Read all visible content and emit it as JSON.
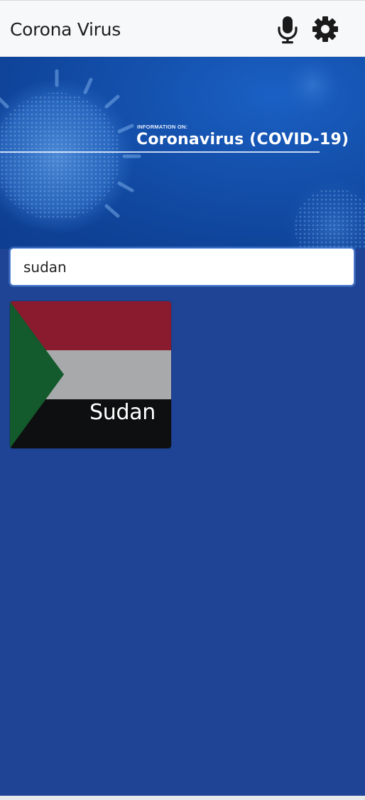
{
  "navbar": {
    "title": "Corona Virus",
    "mic_icon": "microphone-icon",
    "settings_icon": "gear-icon"
  },
  "hero": {
    "small_text": "INFORMATION ON:",
    "title": "Coronavirus (COVID-19)"
  },
  "search": {
    "value": "sudan"
  },
  "results": [
    {
      "name": "Sudan",
      "flag_colors": {
        "top": "#8a1a2e",
        "middle": "#a8a9ab",
        "bottom": "#0e0f10",
        "triangle": "#135a2c"
      }
    }
  ],
  "colors": {
    "background": "#1f4496",
    "navbar": "#f7f8f9",
    "hero": "#1553b0"
  }
}
